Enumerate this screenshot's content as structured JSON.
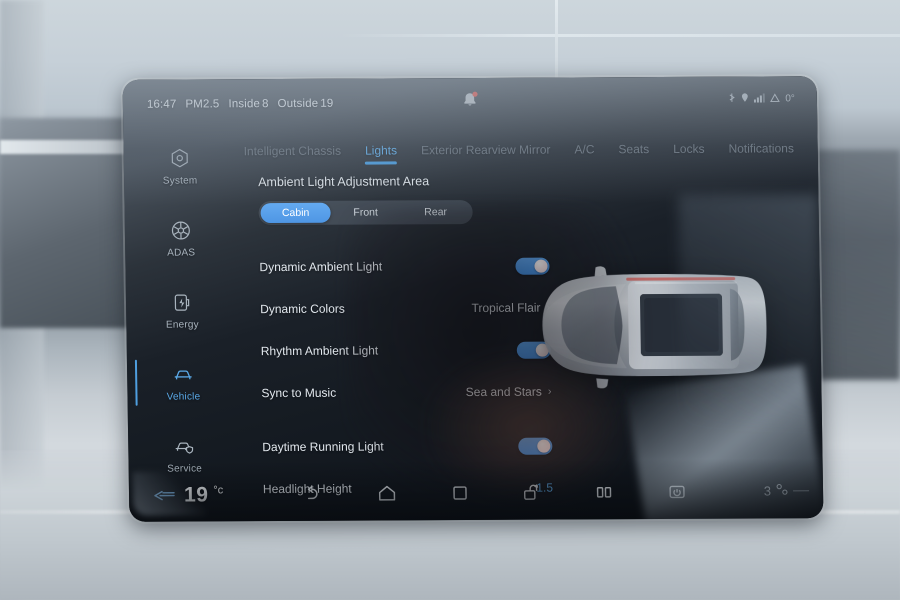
{
  "status_bar": {
    "time": "16:47",
    "pm_label": "PM2.5",
    "inside_label": "Inside",
    "inside_value": "8",
    "outside_label": "Outside",
    "outside_value": "19",
    "notification_icon": "bell-icon",
    "right_icons": [
      "bluetooth-icon",
      "location-icon",
      "signal-icon",
      "altitude-icon"
    ],
    "heading_value": "0°"
  },
  "sidebar": {
    "items": [
      {
        "label": "System",
        "icon": "hexagon-gear-icon",
        "active": false
      },
      {
        "label": "ADAS",
        "icon": "radar-wheel-icon",
        "active": false
      },
      {
        "label": "Energy",
        "icon": "battery-bolt-icon",
        "active": false
      },
      {
        "label": "Vehicle",
        "icon": "car-front-icon",
        "active": true
      },
      {
        "label": "Service",
        "icon": "car-shield-icon",
        "active": false
      }
    ]
  },
  "tabs": [
    {
      "label": "Intelligent Chassis",
      "active": false
    },
    {
      "label": "Lights",
      "active": true
    },
    {
      "label": "Exterior Rearview Mirror",
      "active": false
    },
    {
      "label": "A/C",
      "active": false
    },
    {
      "label": "Seats",
      "active": false
    },
    {
      "label": "Locks",
      "active": false
    },
    {
      "label": "Notifications",
      "active": false
    }
  ],
  "main": {
    "section_title": "Ambient Light Adjustment Area",
    "segments": [
      {
        "label": "Cabin",
        "active": true
      },
      {
        "label": "Front",
        "active": false
      },
      {
        "label": "Rear",
        "active": false
      }
    ],
    "rows": [
      {
        "label": "Dynamic Ambient Light",
        "type": "toggle",
        "value": "on"
      },
      {
        "label": "Dynamic Colors",
        "type": "link",
        "value": "Tropical Flair"
      },
      {
        "label": "Rhythm Ambient Light",
        "type": "toggle",
        "value": "on"
      },
      {
        "label": "Sync to Music",
        "type": "link",
        "value": "Sea and Stars"
      },
      {
        "label": "Daytime Running Light",
        "type": "toggle",
        "value": "on"
      },
      {
        "label": "Headlight Height",
        "type": "number",
        "value": "1.5"
      }
    ],
    "chevron": "›"
  },
  "bottom_bar": {
    "temperature": "19",
    "temperature_unit": "°c",
    "fan_icon": "fan-airflow-icon",
    "nav_icons": [
      "back-icon",
      "home-icon",
      "recents-icon",
      "screen-rotate-icon",
      "split-screen-icon",
      "power-icon"
    ],
    "right_meta": "3"
  },
  "colors": {
    "accent": "#4f9fe0",
    "accent_light": "#67b2ec",
    "toggle_on": "#4a95e2",
    "text_primary": "#e2e8ee",
    "text_muted": "#8c97a2",
    "screen_bg": "#131920"
  }
}
